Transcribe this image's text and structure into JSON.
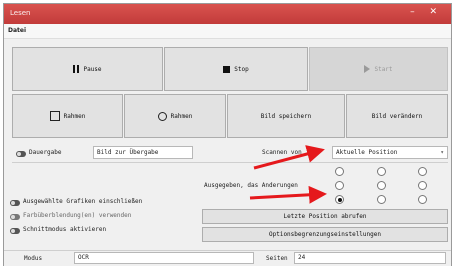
{
  "window": {
    "title": "Lesen",
    "controls": "– ✕"
  },
  "menu": {
    "label": "Datei"
  },
  "row1": {
    "pause_label": "Pause",
    "stop_label": "Stop",
    "start_label": "Start"
  },
  "row2": {
    "b1_label": "Rahmen",
    "b2_label": "Rahmen",
    "b3_label": "Bild speichern",
    "b4_label": "Bild verändern"
  },
  "mid": {
    "check_label": "Dauergabe",
    "left_combo_value": "Bild zur Übergabe",
    "right_label": "Scannen von",
    "right_combo_value": "Aktuelle Position"
  },
  "options": [
    {
      "label": "Ausgewählte Grafiken einschließen"
    },
    {
      "label": "Farbüberblendung(en) verwenden"
    },
    {
      "label": "Schnittmodus aktivieren"
    }
  ],
  "group": {
    "label": "Ausgegeben, das Anderungen"
  },
  "radios": [
    [
      false,
      false,
      false
    ],
    [
      false,
      false,
      false
    ],
    [
      true,
      false,
      false
    ]
  ],
  "actions": {
    "last_position": "Letzte Position abrufen",
    "options": "Optionsbegrenzungseinstellungen"
  },
  "status": {
    "left_label": "Modus",
    "left_value": "OCR",
    "right_label": "Seiten",
    "right_value": "24"
  }
}
